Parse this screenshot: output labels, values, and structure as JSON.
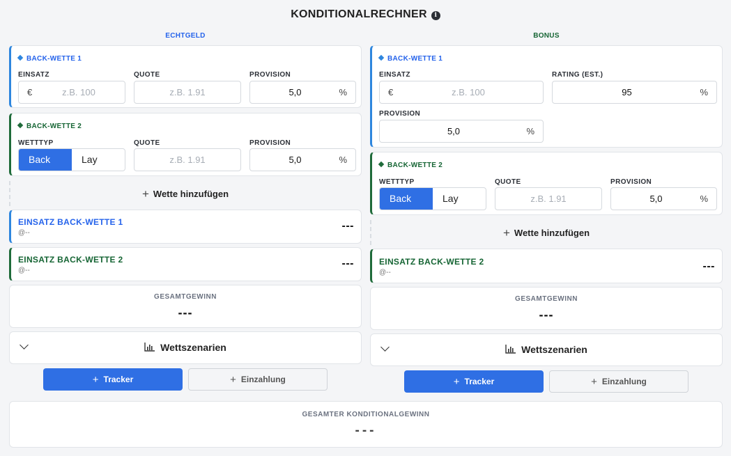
{
  "title": "KONDITIONALRECHNER",
  "colors": {
    "accent": "#2f6fe4",
    "blue_border": "#2e86de",
    "green_border": "#1f6b3a"
  },
  "left": {
    "header": "ECHTGELD",
    "bet1": {
      "title": "BACK-WETTE 1",
      "stake_label": "EINSATZ",
      "currency": "€",
      "stake_placeholder": "z.B. 100",
      "odds_label": "QUOTE",
      "odds_placeholder": "z.B. 1.91",
      "commission_label": "PROVISION",
      "commission_value": "5,0",
      "percent": "%"
    },
    "bet2": {
      "title": "BACK-WETTE 2",
      "type_label": "WETTTYP",
      "type_back": "Back",
      "type_lay": "Lay",
      "odds_label": "QUOTE",
      "odds_placeholder": "z.B. 1.91",
      "commission_label": "PROVISION",
      "commission_value": "5,0",
      "percent": "%"
    },
    "add_bet": "Wette hinzufügen",
    "stake1": {
      "title": "EINSATZ BACK-WETTE 1",
      "sub": "@--",
      "value": "---"
    },
    "stake2": {
      "title": "EINSATZ BACK-WETTE 2",
      "sub": "@--",
      "value": "---"
    },
    "total_label": "GESAMTGEWINN",
    "total_value": "---",
    "scenarios": "Wettszenarien",
    "btn_tracker": "Tracker",
    "btn_deposit": "Einzahlung"
  },
  "right": {
    "header": "BONUS",
    "bet1": {
      "title": "BACK-WETTE 1",
      "stake_label": "EINSATZ",
      "currency": "€",
      "stake_placeholder": "z.B. 100",
      "rating_label": "RATING (EST.)",
      "rating_value": "95",
      "commission_label": "PROVISION",
      "commission_value": "5,0",
      "percent": "%"
    },
    "bet2": {
      "title": "BACK-WETTE 2",
      "type_label": "WETTTYP",
      "type_back": "Back",
      "type_lay": "Lay",
      "odds_label": "QUOTE",
      "odds_placeholder": "z.B. 1.91",
      "commission_label": "PROVISION",
      "commission_value": "5,0",
      "percent": "%"
    },
    "add_bet": "Wette hinzufügen",
    "stake2": {
      "title": "EINSATZ BACK-WETTE 2",
      "sub": "@--",
      "value": "---"
    },
    "total_label": "GESAMTGEWINN",
    "total_value": "---",
    "scenarios": "Wettszenarien",
    "btn_tracker": "Tracker",
    "btn_deposit": "Einzahlung"
  },
  "grand_total": {
    "label": "GESAMTER KONDITIONALGEWINN",
    "value": "---"
  }
}
